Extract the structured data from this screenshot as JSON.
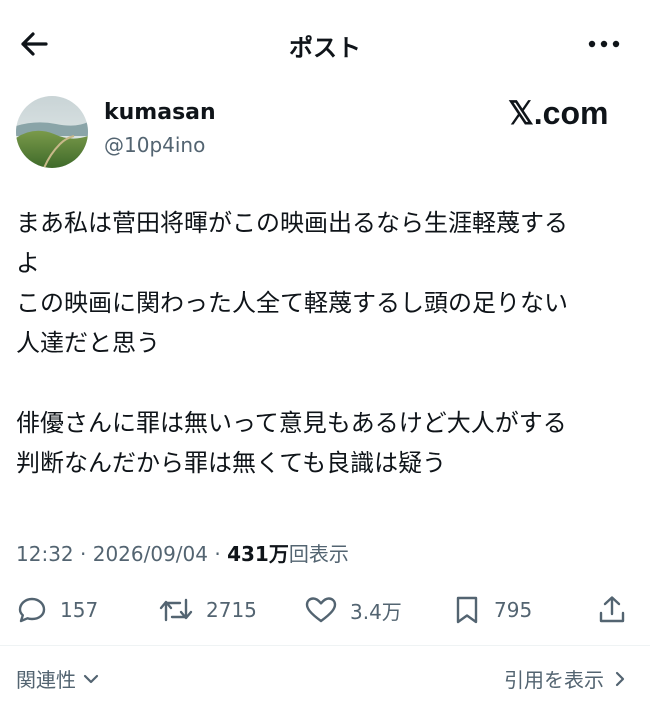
{
  "header": {
    "title": "ポスト",
    "back_icon": "arrow-left-icon",
    "more_icon": "more-horizontal-icon"
  },
  "author": {
    "display_name": "kumasan",
    "handle": "@10p4ino",
    "avatar": "avatar-landscape"
  },
  "brand": "𝕏.com",
  "post": {
    "lines": [
      "まあ私は菅田将暉がこの映画出るなら生涯軽蔑する",
      "よ",
      "この映画に関わった人全て軽蔑するし頭の足りない",
      "人達だと思う",
      "",
      "俳優さんに罪は無いって意見もあるけど大人がする",
      "判断なんだから罪は無くても良識は疑う"
    ]
  },
  "meta": {
    "time": "12:32",
    "date": "2026/09/04",
    "separator": "·",
    "views_count": "431万",
    "views_label": "回表示"
  },
  "actions": {
    "replies": "157",
    "reposts": "2715",
    "likes": "3.4万",
    "bookmarks": "795"
  },
  "footer": {
    "sort_label": "関連性",
    "quotes_label": "引用を表示"
  },
  "colors": {
    "text": "#0f1419",
    "secondary": "#536471",
    "background": "#ffffff"
  }
}
